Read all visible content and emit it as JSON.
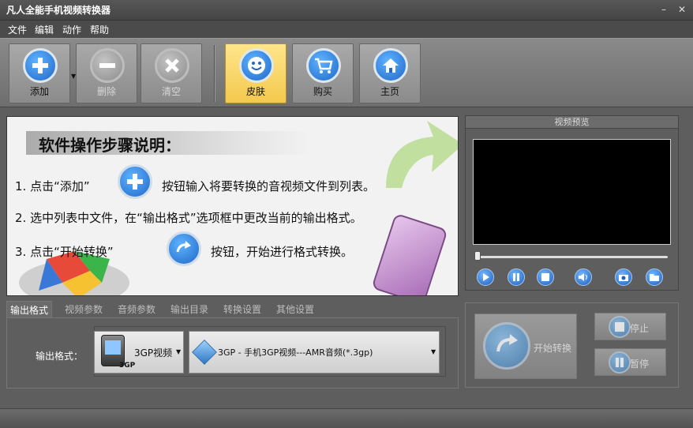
{
  "window": {
    "title": "凡人全能手机视频转换器",
    "minimize": "–",
    "close": "✕"
  },
  "menu": [
    "文件",
    "编辑",
    "动作",
    "帮助"
  ],
  "toolbar": {
    "add": "添加",
    "delete": "删除",
    "clear": "清空",
    "skin": "皮肤",
    "buy": "购买",
    "home": "主页"
  },
  "guide": {
    "heading": "软件操作步骤说明：",
    "step1_pre": "1. 点击“添加”",
    "step1_post": "按钮输入将要转换的音视频文件到列表。",
    "step2": "2. 选中列表中文件，在“输出格式”选项框中更改当前的输出格式。",
    "step3_pre": "3. 点击“开始转换”",
    "step3_post": "按钮，开始进行格式转换。"
  },
  "preview": {
    "title": "视频预览",
    "progress": 0
  },
  "tabs": [
    "输出格式",
    "视频参数",
    "音频参数",
    "输出目录",
    "转换设置",
    "其他设置"
  ],
  "output": {
    "label": "输出格式：",
    "device": "3GP视频",
    "device_tag": "3GP",
    "format": "3GP - 手机3GP视频---AMR音频(*.3gp)"
  },
  "controls": {
    "start": "开始转换",
    "stop": "停止",
    "pause": "暂停"
  },
  "colors": {
    "accent": "#1f68c9",
    "skin_active": "#f3c94e"
  }
}
